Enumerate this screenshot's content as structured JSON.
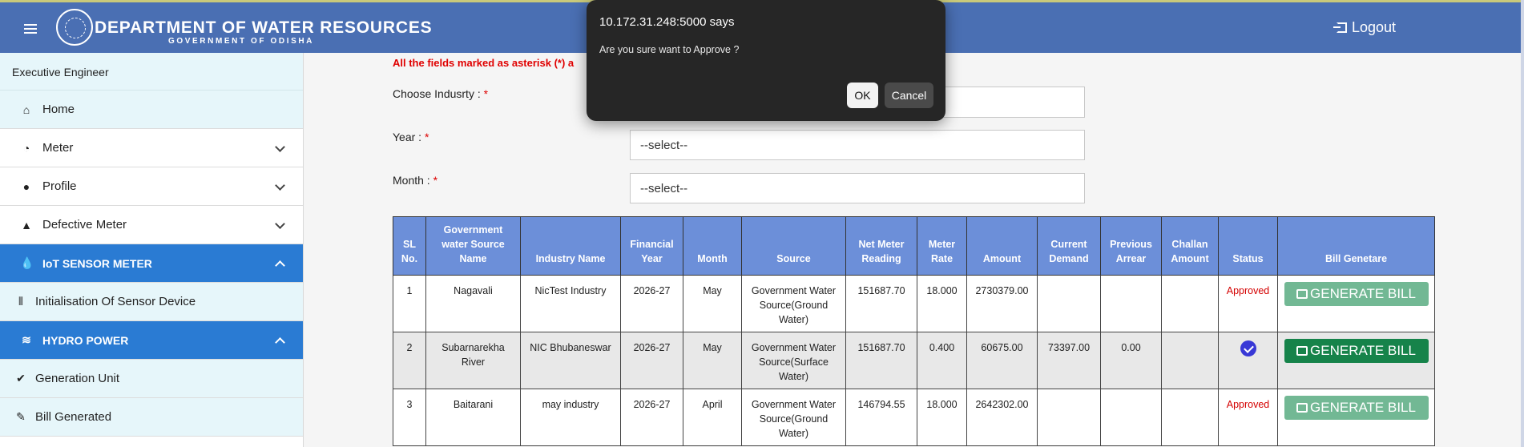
{
  "header": {
    "title": "DEPARTMENT OF WATER RESOURCES",
    "subtitle": "GOVERNMENT OF ODISHA",
    "logout_label": "Logout",
    "colors": {
      "bar": "#4a6fb3"
    }
  },
  "sidebar": {
    "role": "Executive Engineer",
    "items": [
      {
        "label": "Home",
        "icon": "home-icon"
      },
      {
        "label": "Meter",
        "icon": "gauge-icon"
      },
      {
        "label": "Profile",
        "icon": "user-icon"
      },
      {
        "label": "Defective Meter",
        "icon": "warning-icon"
      },
      {
        "label": "IoT SENSOR METER",
        "icon": "water-drop-icon"
      },
      {
        "label": "Initialisation Of Sensor Device",
        "icon": "sensor-wave-icon"
      },
      {
        "label": "HYDRO POWER",
        "icon": "water-waves-icon"
      },
      {
        "label": "Generation Unit",
        "icon": "check-circle-icon"
      },
      {
        "label": "Bill Generated",
        "icon": "edit-note-icon"
      }
    ]
  },
  "form": {
    "notice": "All the fields marked as asterisk (*) a",
    "industry_label": "Choose Indusrty : ",
    "year_label": "Year : ",
    "year_value": "--select--",
    "month_label": "Month : ",
    "month_value": "--select--",
    "required_mark": "*"
  },
  "table": {
    "headers": {
      "sl": [
        "SL",
        "No."
      ],
      "source_name": [
        "Government",
        "water Source",
        "Name"
      ],
      "industry": "Industry Name",
      "fy": [
        "Financial",
        "Year"
      ],
      "month": "Month",
      "source": "Source",
      "net_meter": [
        "Net Meter",
        "Reading"
      ],
      "rate": [
        "Meter",
        "Rate"
      ],
      "amount": "Amount",
      "current_demand": [
        "Current",
        "Demand"
      ],
      "previous_arrear": [
        "Previous",
        "Arrear"
      ],
      "challan": [
        "Challan",
        "Amount"
      ],
      "status": "Status",
      "bill": "Bill Genetare"
    },
    "rows": [
      {
        "sl": "1",
        "source_name": [
          "Nagavali"
        ],
        "industry": "NicTest Industry",
        "fy": "2026-27",
        "month": "May",
        "source": [
          "Government Water",
          "Source(Ground",
          "Water)"
        ],
        "net_meter": "151687.70",
        "rate": "18.000",
        "amount": "2730379.00",
        "current_demand": "",
        "previous_arrear": "",
        "challan": "",
        "status": "Approved",
        "bill_label": "GENERATE BILL"
      },
      {
        "sl": "2",
        "source_name": [
          "Subarnarekha",
          "River"
        ],
        "industry": "NIC Bhubaneswar",
        "fy": "2026-27",
        "month": "May",
        "source": [
          "Government Water",
          "Source(Surface",
          "Water)"
        ],
        "net_meter": "151687.70",
        "rate": "0.400",
        "amount": "60675.00",
        "current_demand": "73397.00",
        "previous_arrear": "0.00",
        "challan": "",
        "status_icon": "check-circle-icon",
        "bill_label": "GENERATE BILL"
      },
      {
        "sl": "3",
        "source_name": [
          "Baitarani"
        ],
        "industry": "may industry",
        "fy": "2026-27",
        "month": "April",
        "source": [
          "Government Water",
          "Source(Ground",
          "Water)"
        ],
        "net_meter": "146794.55",
        "rate": "18.000",
        "amount": "2642302.00",
        "current_demand": "",
        "previous_arrear": "",
        "challan": "",
        "status": "Approved",
        "bill_label": "GENERATE BILL"
      }
    ]
  },
  "dialog": {
    "origin": "10.172.31.248:5000 says",
    "message": "Are you sure want to Approve ?",
    "ok_label": "OK",
    "cancel_label": "Cancel"
  }
}
